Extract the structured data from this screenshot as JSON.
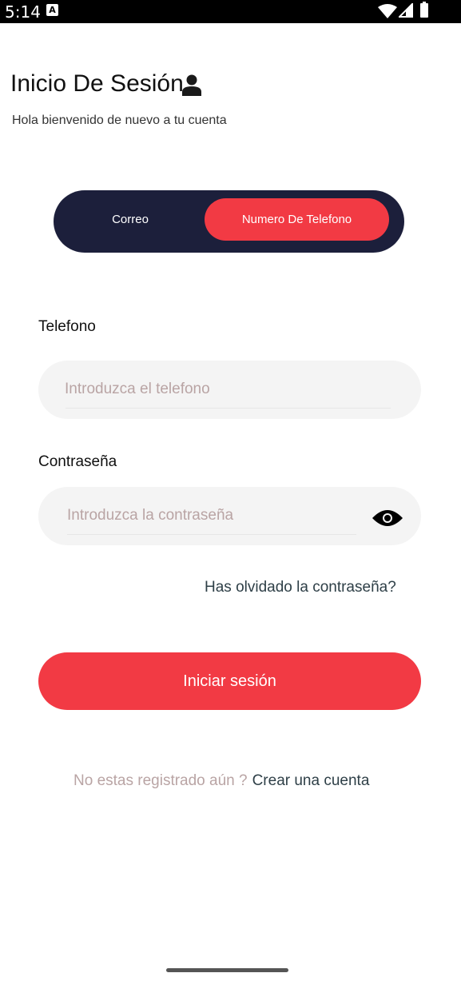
{
  "status_bar": {
    "time": "5:14",
    "notification_glyph": "A"
  },
  "header": {
    "title": "Inicio De Sesión",
    "subtitle": "Hola bienvenido de nuevo a tu cuenta"
  },
  "tabs": {
    "email_label": "Correo",
    "phone_label": "Numero De Telefono",
    "selected": "Numero De Telefono"
  },
  "phone_field": {
    "label": "Telefono",
    "placeholder": "Introduzca el telefono",
    "value": ""
  },
  "password_field": {
    "label": "Contraseña",
    "placeholder": "Introduzca la contraseña",
    "value": ""
  },
  "forgot_password": "Has olvidado la contraseña?",
  "login_button": "Iniciar sesión",
  "register": {
    "question": "No estas registrado aún ?",
    "link": "Crear una cuenta"
  },
  "colors": {
    "accent": "#f23a44",
    "segment_bg": "#1c1f3b",
    "field_bg": "#f4f4f4",
    "link": "#2e3f47",
    "muted": "#b9a4a4"
  },
  "icons": [
    "user-icon",
    "eye-icon",
    "wifi-icon",
    "signal-icon",
    "battery-icon"
  ]
}
